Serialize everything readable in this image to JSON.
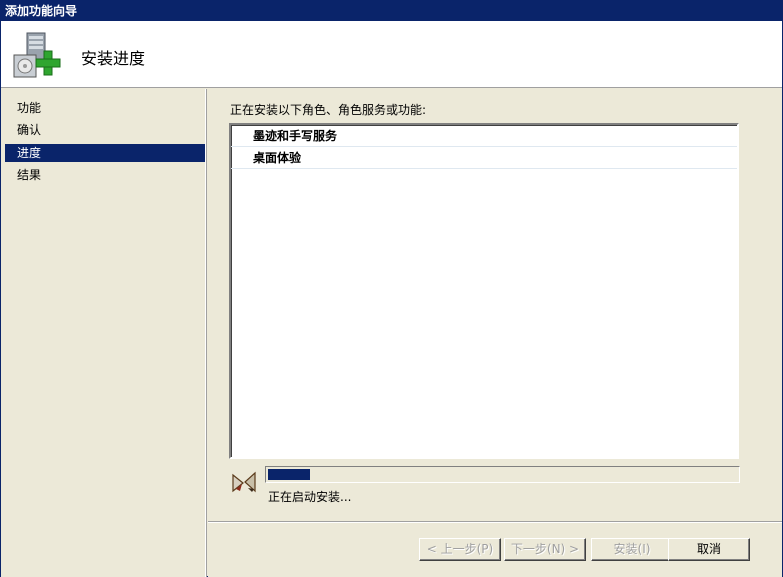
{
  "window": {
    "title": "添加功能向导"
  },
  "header": {
    "title": "安装进度",
    "icon": "server-add-icon"
  },
  "sidebar": {
    "items": [
      {
        "label": "功能",
        "active": false
      },
      {
        "label": "确认",
        "active": false
      },
      {
        "label": "进度",
        "active": true
      },
      {
        "label": "结果",
        "active": false
      }
    ]
  },
  "main": {
    "intro": "正在安装以下角色、角色服务或功能:",
    "features": [
      {
        "label": "墨迹和手写服务"
      },
      {
        "label": "桌面体验"
      }
    ],
    "progress": {
      "fraction": 0.09,
      "status": "正在启动安装..."
    }
  },
  "footer": {
    "back_label": "< 上一步(P)",
    "next_label": "下一步(N) >",
    "install_label": "安装(I)",
    "cancel_label": "取消"
  },
  "colors": {
    "accent": "#0a246a",
    "background": "#ece9d8"
  }
}
